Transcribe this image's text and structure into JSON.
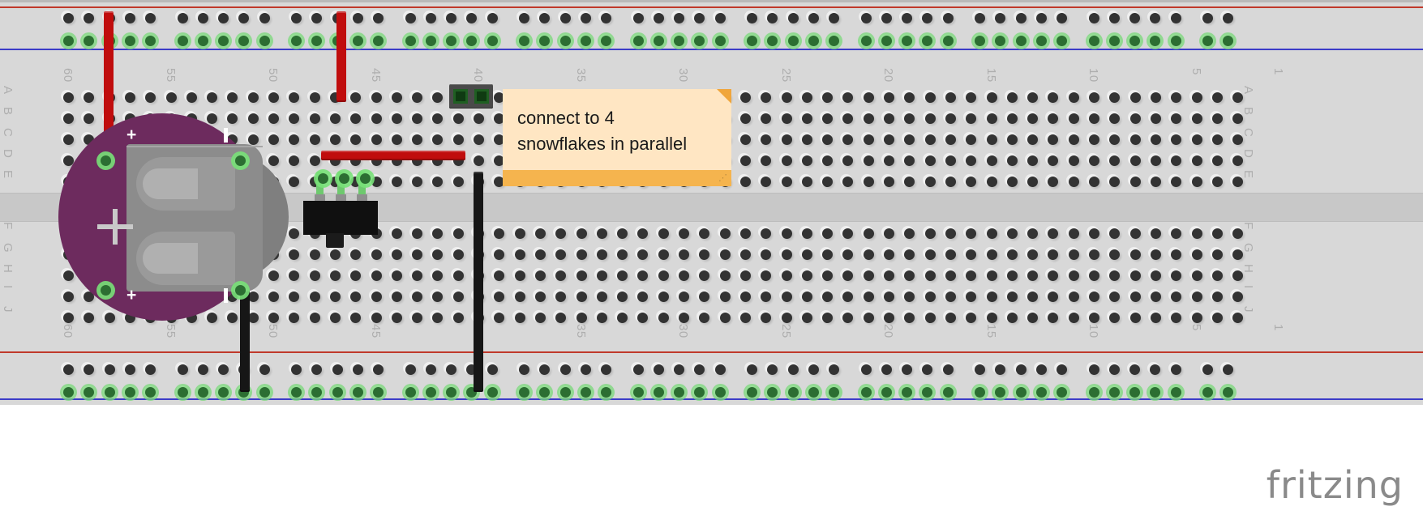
{
  "app": {
    "name": "fritzing",
    "view": "breadboard",
    "logo_text": "fritzing"
  },
  "breadboard": {
    "label": "full-size solderless breadboard",
    "column_labels_top": [
      "60",
      "55",
      "50",
      "45",
      "40",
      "35",
      "30",
      "25",
      "20",
      "15",
      "10",
      "5",
      "1"
    ],
    "column_labels_bottom": [
      "60",
      "55",
      "50",
      "45",
      "40",
      "35",
      "30",
      "25",
      "20",
      "15",
      "10",
      "5",
      "1"
    ],
    "row_labels_left_upper": [
      "A",
      "B",
      "C",
      "D",
      "E"
    ],
    "row_labels_left_lower": [
      "F",
      "G",
      "H",
      "I",
      "J"
    ],
    "row_labels_right_upper": [
      "A",
      "B",
      "C",
      "D",
      "E"
    ],
    "row_labels_right_lower": [
      "F",
      "G",
      "H",
      "I",
      "J"
    ],
    "rail_positive_color": "#c0392b",
    "rail_negative_color": "#3c3cc8",
    "body_color": "#d8d8d8",
    "hole_color": "#333333",
    "connected_hole_color": "#2c6e32"
  },
  "components": {
    "battery_holder": {
      "name": "Coin Cell Battery Holder 20mm",
      "pcb_color": "#6d2b5e",
      "plus_marker": "+",
      "minus_marker": "-",
      "center_marker": "+"
    },
    "slide_switch": {
      "name": "Slide Switch SPDT",
      "body_color": "#101010",
      "pin_count": 3
    },
    "pin_header": {
      "name": "Female Pin Header 2-pin",
      "body_color": "#4a4a4a",
      "pin_count": 2
    }
  },
  "wires": [
    {
      "name": "battery-plus-to-top-rail",
      "color": "red",
      "hex": "#c00d0d"
    },
    {
      "name": "header-to-top-rail",
      "color": "red",
      "hex": "#c00d0d"
    },
    {
      "name": "header-to-switch-row",
      "color": "red",
      "hex": "#c00d0d"
    },
    {
      "name": "battery-minus-to-bottom-rail",
      "color": "black",
      "hex": "#161616"
    },
    {
      "name": "header-ground-to-bottom-rail",
      "color": "black",
      "hex": "#161616"
    }
  ],
  "note": {
    "text": "connect to 4\nsnowflakes in parallel",
    "background": "#ffe6c3",
    "accent": "#f5b44e",
    "resize_grip": "⋰"
  }
}
